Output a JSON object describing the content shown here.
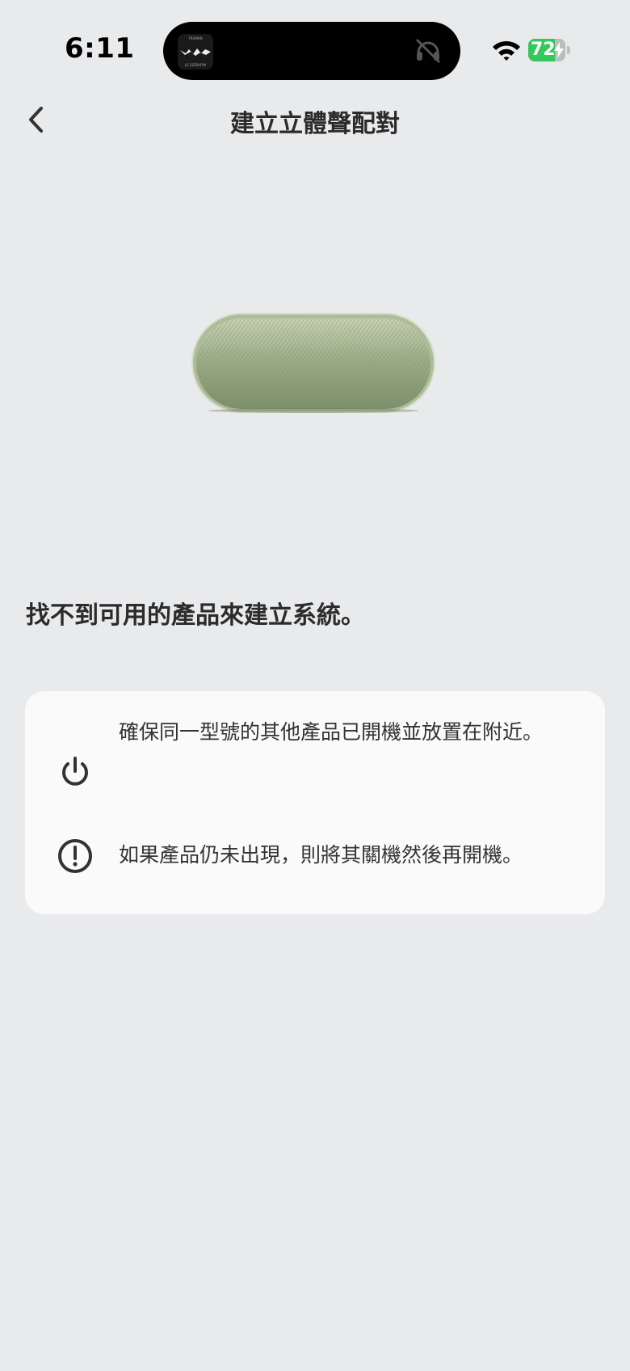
{
  "status_bar": {
    "time": "6:11",
    "battery_level": "72",
    "battery_fraction": 0.72,
    "island_thumb_top": "TRUMAN",
    "island_thumb_bottom": "LE SSERAFIM"
  },
  "nav": {
    "title": "建立立體聲配對",
    "back_icon": "chevron-left-icon"
  },
  "product": {
    "color": "#9db08c"
  },
  "message": {
    "heading": "找不到可用的產品來建立系統。"
  },
  "tips": [
    {
      "icon": "power-icon",
      "text": "確保同一型號的其他產品已開機並放置在附近。"
    },
    {
      "icon": "alert-circle-icon",
      "text": "如果產品仍未出現，則將其關機然後再開機。"
    }
  ],
  "colors": {
    "background": "#e9eaec",
    "card": "#fafafa",
    "text": "#2b2b2b",
    "battery": "#34c759"
  }
}
